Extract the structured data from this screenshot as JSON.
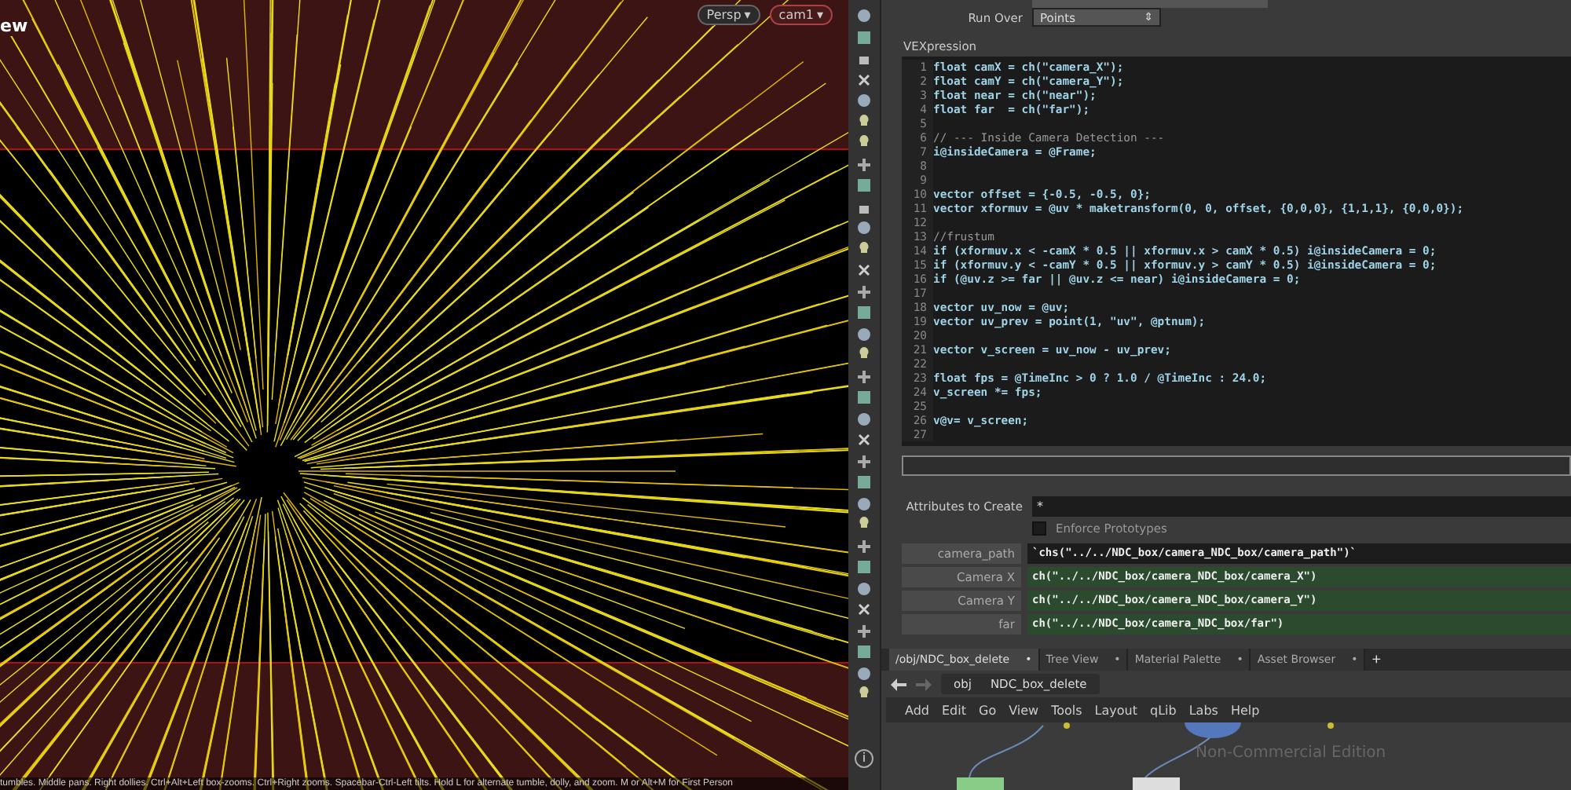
{
  "viewport": {
    "title": "ew",
    "camera_menus": [
      {
        "label": "Persp",
        "kind": "plain"
      },
      {
        "label": "cam1",
        "kind": "camera"
      }
    ],
    "menu_caret": "▾",
    "status": "tumbles. Middle pans. Right dollies. Ctrl+Alt+Left box-zooms. Ctrl+Right zooms. Spacebar-Ctrl-Left tilts. Hold L for alternate tumble, dolly, and zoom. M or Alt+M for First Person"
  },
  "toolbar": {
    "info": "i"
  },
  "parameters": {
    "run_over": {
      "label": "Run Over",
      "value": "Points",
      "spinner": "⇕"
    },
    "vexpression": {
      "label": "VEXpression",
      "lines": [
        {
          "n": "1",
          "text": "float camX = ch(\"camera_X\");"
        },
        {
          "n": "2",
          "text": "float camY = ch(\"camera_Y\");"
        },
        {
          "n": "3",
          "text": "float near = ch(\"near\");"
        },
        {
          "n": "4",
          "text": "float far  = ch(\"far\");"
        },
        {
          "n": "5"
        },
        {
          "n": "6",
          "text": "// --- Inside Camera Detection ---"
        },
        {
          "n": "7",
          "text": "i@insideCamera = @Frame;"
        },
        {
          "n": "8"
        },
        {
          "n": "9"
        },
        {
          "n": "10",
          "text": "vector offset = {-0.5, -0.5, 0};"
        },
        {
          "n": "11",
          "text": "vector xformuv = @uv * maketransform(0, 0, offset, {0,0,0}, {1,1,1}, {0,0,0});"
        },
        {
          "n": "12"
        },
        {
          "n": "13",
          "text": "//frustum"
        },
        {
          "n": "14",
          "text": "if (xformuv.x < -camX * 0.5 || xformuv.x > camX * 0.5) i@insideCamera = 0;"
        },
        {
          "n": "15",
          "text": "if (xformuv.y < -camY * 0.5 || xformuv.y > camY * 0.5) i@insideCamera = 0;"
        },
        {
          "n": "16",
          "text": "if (@uv.z >= far || @uv.z <= near) i@insideCamera = 0;"
        },
        {
          "n": "17"
        },
        {
          "n": "18",
          "text": "vector uv_now = @uv;"
        },
        {
          "n": "19",
          "text": "vector uv_prev = point(1, \"uv\", @ptnum);"
        },
        {
          "n": "20"
        },
        {
          "n": "21",
          "text": "vector v_screen = uv_now - uv_prev;"
        },
        {
          "n": "22"
        },
        {
          "n": "23",
          "text": "float fps = @TimeInc > 0 ? 1.0 / @TimeInc : 24.0;"
        },
        {
          "n": "24",
          "text": "v_screen *= fps;"
        },
        {
          "n": "25"
        },
        {
          "n": "26",
          "text": "v@v= v_screen;"
        },
        {
          "n": "27"
        }
      ]
    },
    "attributes_to_create": {
      "label": "Attributes to Create",
      "value": "*"
    },
    "enforce_prototypes": {
      "label": "Enforce Prototypes",
      "checked": false
    },
    "fields": [
      {
        "label": "camera_path",
        "value": "`chs(\"../../NDC_box/camera_NDC_box/camera_path\")`",
        "kind": "string"
      },
      {
        "label": "Camera X",
        "value": "ch(\"../../NDC_box/camera_NDC_box/camera_X\")",
        "kind": "expression"
      },
      {
        "label": "Camera Y",
        "value": "ch(\"../../NDC_box/camera_NDC_box/camera_Y\")",
        "kind": "expression"
      },
      {
        "label": "far",
        "value": "ch(\"../../NDC_box/camera_NDC_box/far\")",
        "kind": "expression"
      }
    ]
  },
  "network": {
    "tabs": [
      {
        "label": "/obj/NDC_box_delete",
        "selected": true,
        "close": "•"
      },
      {
        "label": "Tree View",
        "selected": false,
        "close": "•"
      },
      {
        "label": "Material Palette",
        "selected": false,
        "close": "•"
      },
      {
        "label": "Asset Browser",
        "selected": false,
        "close": "•"
      }
    ],
    "add_tab": "+",
    "path": [
      "obj",
      "NDC_box_delete"
    ],
    "menu": [
      "Add",
      "Edit",
      "Go",
      "View",
      "Tools",
      "Layout",
      "qLib",
      "Labs",
      "Help"
    ],
    "edition": "Non-Commercial Edition"
  }
}
